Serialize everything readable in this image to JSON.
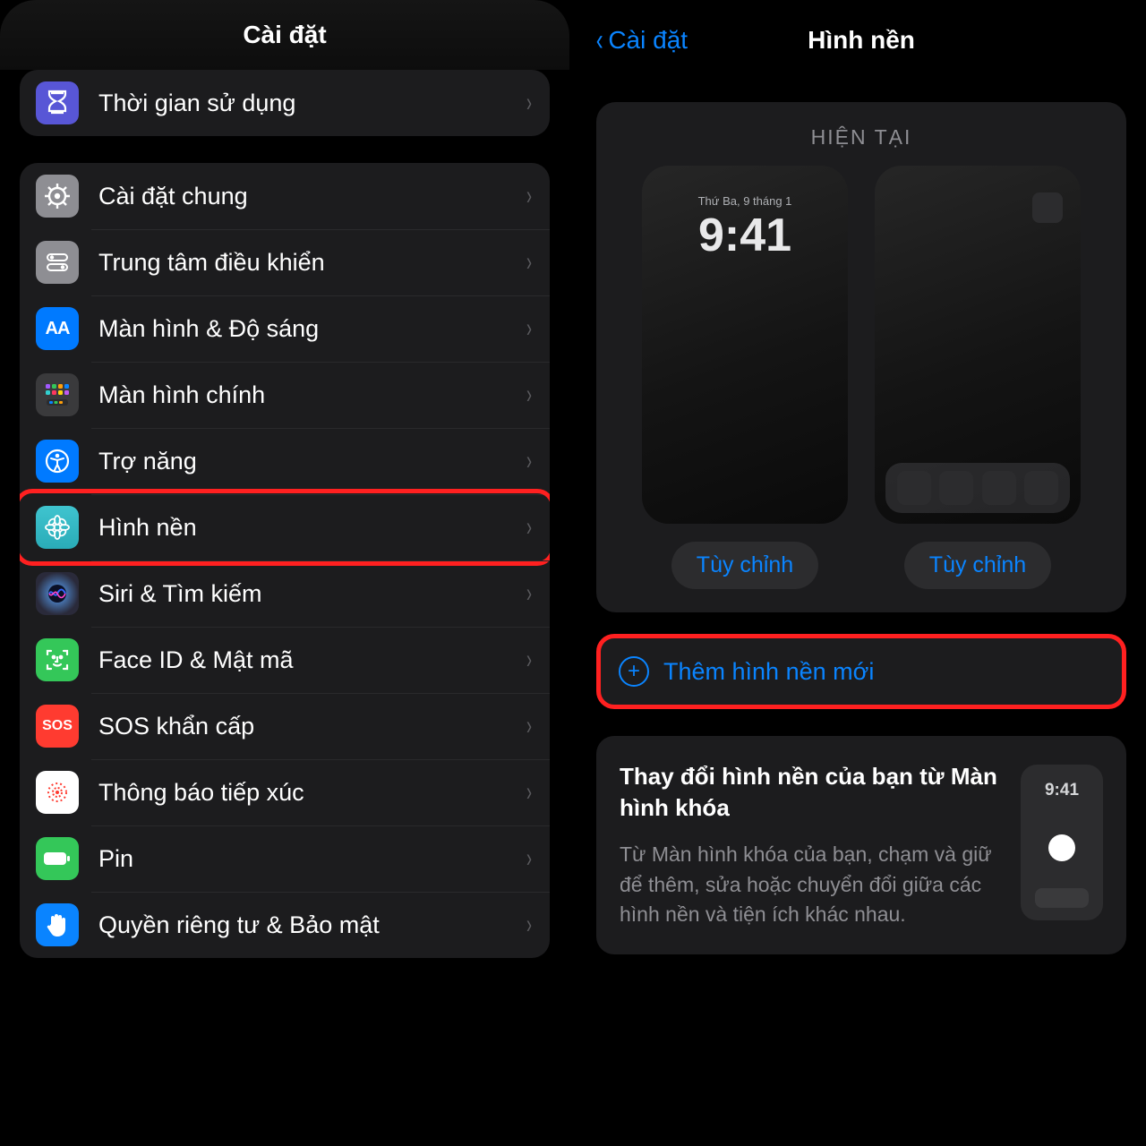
{
  "left": {
    "title": "Cài đặt",
    "group0": {
      "screentime": "Thời gian sử dụng"
    },
    "rows": {
      "general": "Cài đặt chung",
      "controlcenter": "Trung tâm điều khiển",
      "display": "Màn hình & Độ sáng",
      "home": "Màn hình chính",
      "accessibility": "Trợ năng",
      "wallpaper": "Hình nền",
      "siri": "Siri & Tìm kiếm",
      "faceid": "Face ID & Mật mã",
      "sos": "SOS khẩn cấp",
      "exposure": "Thông báo tiếp xúc",
      "battery": "Pin",
      "privacy": "Quyền riêng tư & Bảo mật"
    },
    "sos_label": "SOS"
  },
  "right": {
    "back": "Cài đặt",
    "title": "Hình nền",
    "current_header": "HIỆN TẠI",
    "lock_date": "Thứ Ba, 9 tháng 1",
    "lock_time": "9:41",
    "customize": "Tùy chỉnh",
    "add_new": "Thêm hình nền mới",
    "tip_title": "Thay đổi hình nền của bạn từ Màn hình khóa",
    "tip_body": "Từ Màn hình khóa của bạn, chạm và giữ để thêm, sửa hoặc chuyển đổi giữa các hình nền và tiện ích khác nhau.",
    "tip_time": "9:41"
  }
}
